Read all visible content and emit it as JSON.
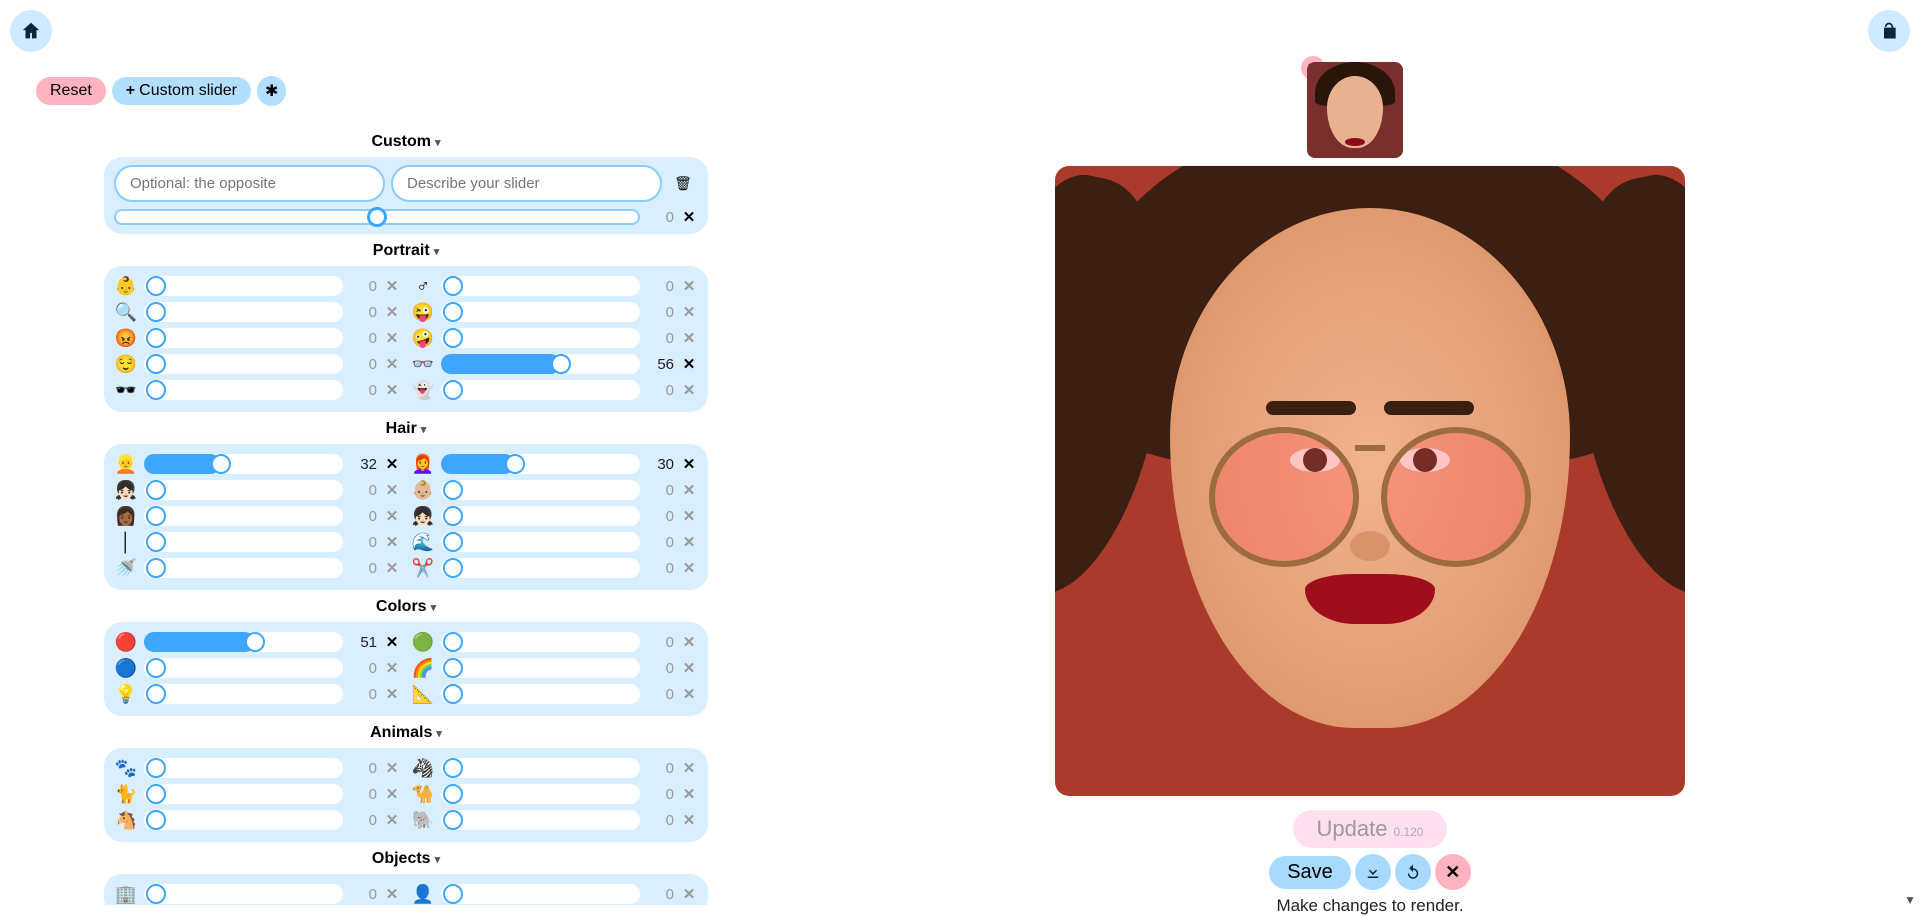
{
  "toolbar": {
    "reset_label": "Reset",
    "custom_slider_label": "Custom slider"
  },
  "custom_section": {
    "header": "Custom",
    "placeholder_left": "Optional: the opposite",
    "placeholder_right": "Describe your slider",
    "value": 0
  },
  "sections": [
    {
      "name": "Portrait",
      "rows": [
        {
          "left": {
            "icon": "👶",
            "value": 0
          },
          "right": {
            "icon": "♂",
            "value": 0
          }
        },
        {
          "left": {
            "icon": "🔍",
            "value": 0
          },
          "right": {
            "icon": "😜",
            "value": 0
          }
        },
        {
          "left": {
            "icon": "😡",
            "value": 0
          },
          "right": {
            "icon": "🤪",
            "value": 0
          }
        },
        {
          "left": {
            "icon": "😌",
            "value": 0
          },
          "right": {
            "icon": "👓",
            "value": 56
          }
        },
        {
          "left": {
            "icon": "🕶️",
            "value": 0
          },
          "right": {
            "icon": "👻",
            "value": 0
          }
        }
      ]
    },
    {
      "name": "Hair",
      "rows": [
        {
          "left": {
            "icon": "👱",
            "value": 32
          },
          "right": {
            "icon": "👩‍🦰",
            "value": 30
          }
        },
        {
          "left": {
            "icon": "👧🏻",
            "value": 0
          },
          "right": {
            "icon": "👶🏼",
            "value": 0
          }
        },
        {
          "left": {
            "icon": "👩🏾",
            "value": 0
          },
          "right": {
            "icon": "👧🏻",
            "value": 0
          }
        },
        {
          "left": {
            "icon": "│",
            "value": 0
          },
          "right": {
            "icon": "🌊",
            "value": 0
          }
        },
        {
          "left": {
            "icon": "🚿",
            "value": 0
          },
          "right": {
            "icon": "✂️",
            "value": 0
          }
        }
      ]
    },
    {
      "name": "Colors",
      "rows": [
        {
          "left": {
            "icon": "🔴",
            "value": 51
          },
          "right": {
            "icon": "🟢",
            "value": 0
          }
        },
        {
          "left": {
            "icon": "🔵",
            "value": 0
          },
          "right": {
            "icon": "🌈",
            "value": 0
          }
        },
        {
          "left": {
            "icon": "💡",
            "value": 0
          },
          "right": {
            "icon": "📐",
            "value": 0
          }
        }
      ]
    },
    {
      "name": "Animals",
      "rows": [
        {
          "left": {
            "icon": "🐾",
            "value": 0
          },
          "right": {
            "icon": "🦓",
            "value": 0
          }
        },
        {
          "left": {
            "icon": "🐈",
            "value": 0
          },
          "right": {
            "icon": "🐪",
            "value": 0
          }
        },
        {
          "left": {
            "icon": "🐴",
            "value": 0
          },
          "right": {
            "icon": "🐘",
            "value": 0
          }
        }
      ]
    },
    {
      "name": "Objects",
      "rows": [
        {
          "left": {
            "icon": "🏢",
            "value": 0
          },
          "right": {
            "icon": "👤",
            "value": 0
          }
        }
      ]
    }
  ],
  "preview": {
    "update_label": "Update",
    "update_version": "0.120",
    "save_label": "Save",
    "status_text": "Make changes to render."
  }
}
